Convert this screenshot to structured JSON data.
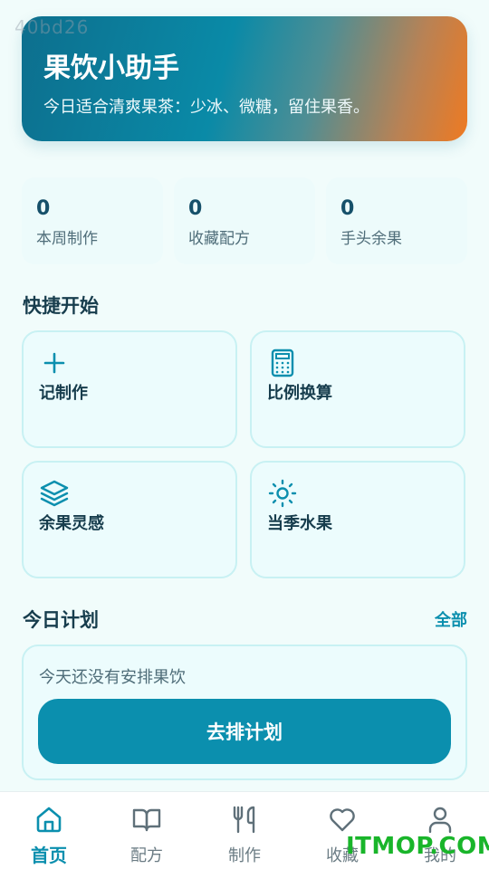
{
  "watermark_top": "40bd26",
  "hero": {
    "title": "果饮小助手",
    "subtitle": "今日适合清爽果茶：少冰、微糖，留住果香。"
  },
  "stats": [
    {
      "value": "0",
      "label": "本周制作"
    },
    {
      "value": "0",
      "label": "收藏配方"
    },
    {
      "value": "0",
      "label": "手头余果"
    }
  ],
  "quick_start": {
    "title": "快捷开始",
    "cards": [
      {
        "label": "记制作",
        "icon": "plus-icon"
      },
      {
        "label": "比例换算",
        "icon": "calculator-icon"
      },
      {
        "label": "余果灵感",
        "icon": "layers-icon"
      },
      {
        "label": "当季水果",
        "icon": "sun-icon"
      }
    ]
  },
  "today_plan": {
    "title": "今日计划",
    "all_link": "全部",
    "empty_text": "今天还没有安排果饮",
    "button": "去排计划"
  },
  "tabbar": {
    "items": [
      {
        "label": "首页",
        "icon": "home-icon",
        "active": true
      },
      {
        "label": "配方",
        "icon": "book-icon",
        "active": false
      },
      {
        "label": "制作",
        "icon": "utensils-icon",
        "active": false
      },
      {
        "label": "收藏",
        "icon": "heart-icon",
        "active": false
      },
      {
        "label": "我的",
        "icon": "user-icon",
        "active": false
      }
    ]
  },
  "watermark_bottom": "ITMOP.COM",
  "colors": {
    "accent": "#0b8fae",
    "hero_start": "#0d6f8e",
    "hero_end": "#ee7a22",
    "background": "#f1fcfb",
    "card_border": "#c8f1f3"
  }
}
